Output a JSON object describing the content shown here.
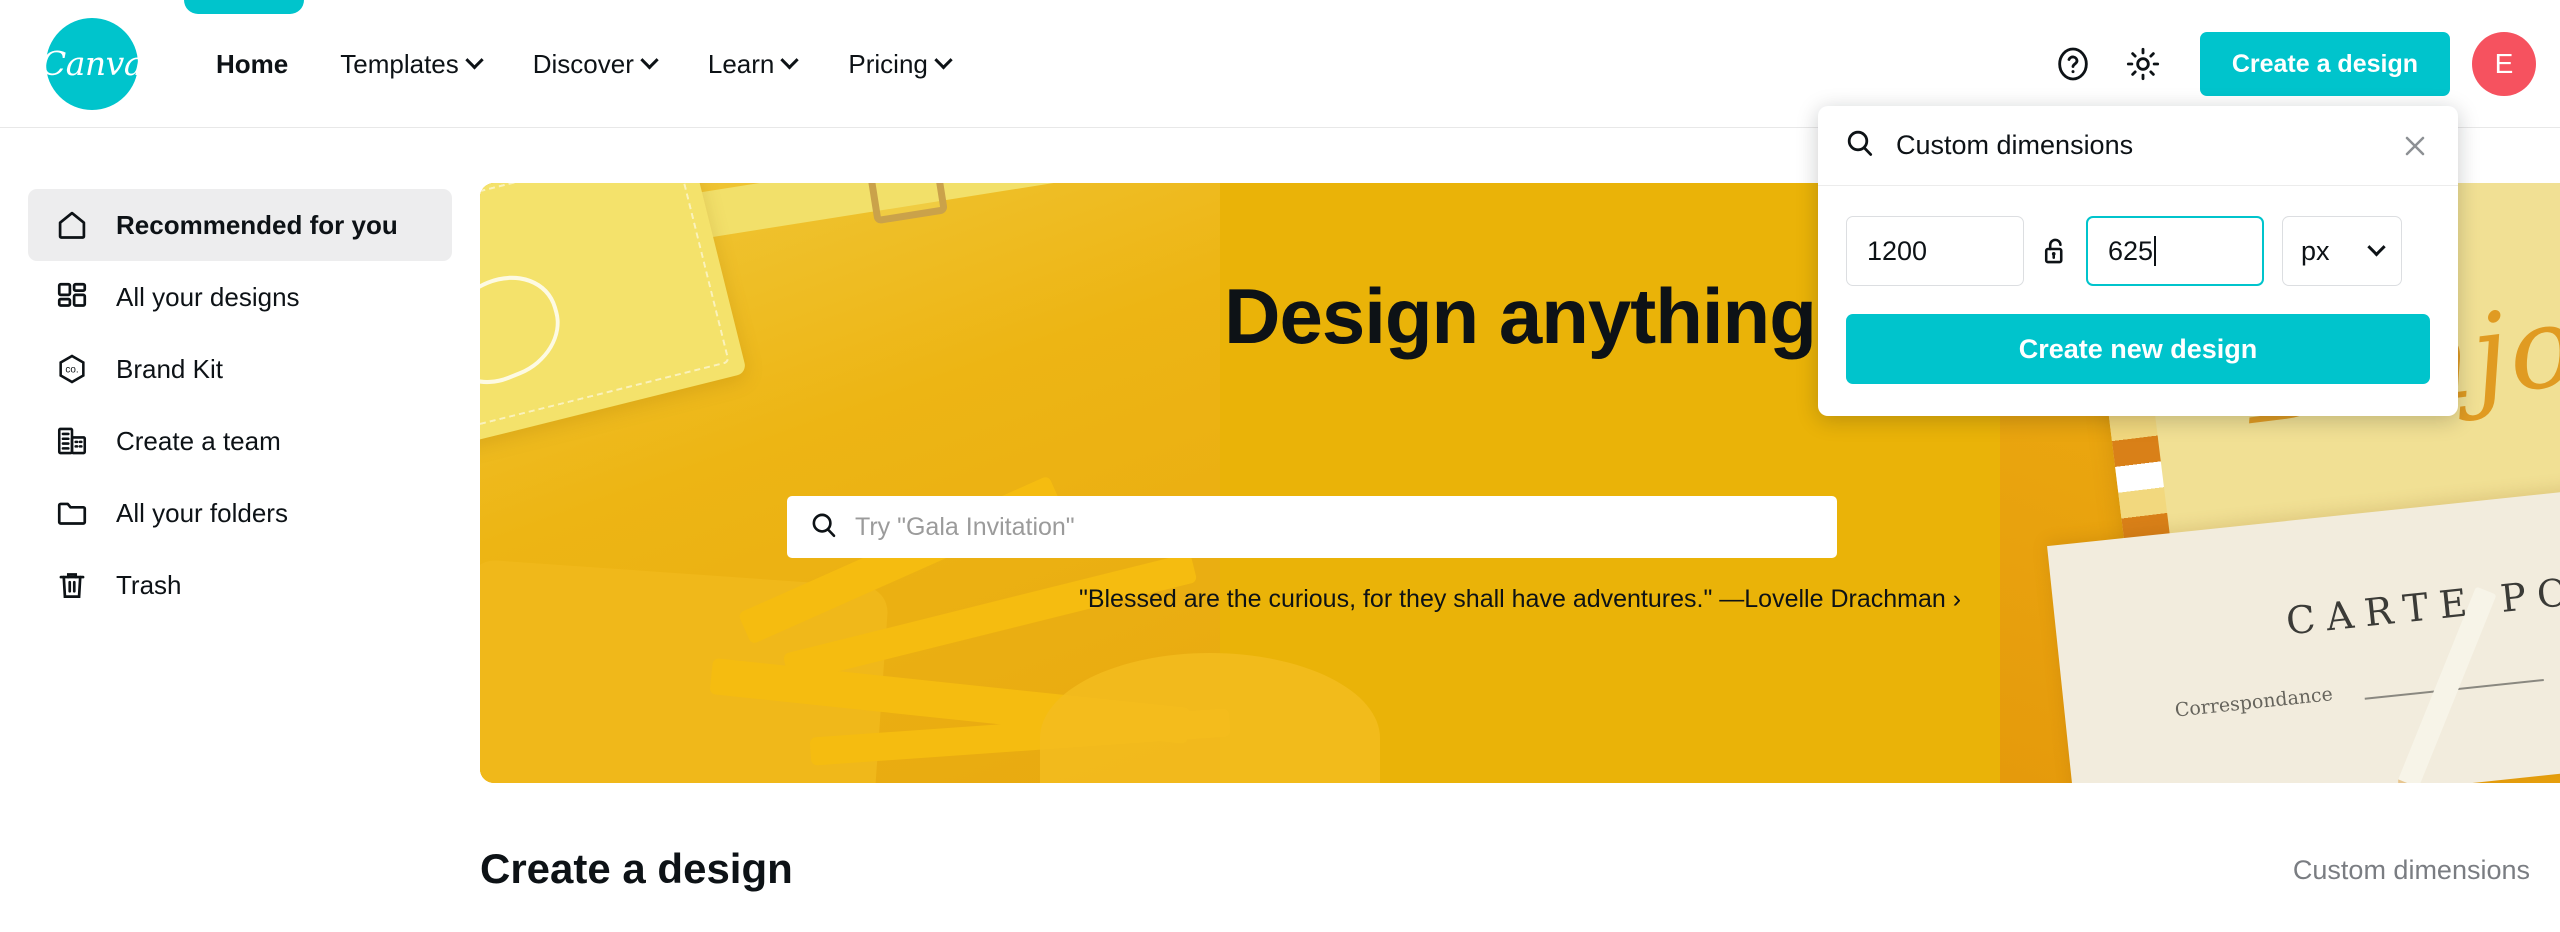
{
  "brand": {
    "logo_text": "Canva",
    "accent_color": "#00c4cc",
    "avatar_color": "#f6525f",
    "banner_color": "#eab308"
  },
  "header": {
    "nav": [
      {
        "label": "Home",
        "has_chevron": false,
        "active": true
      },
      {
        "label": "Templates",
        "has_chevron": true,
        "active": false
      },
      {
        "label": "Discover",
        "has_chevron": true,
        "active": false
      },
      {
        "label": "Learn",
        "has_chevron": true,
        "active": false
      },
      {
        "label": "Pricing",
        "has_chevron": true,
        "active": false
      }
    ],
    "help_icon": "help-circle-icon",
    "settings_icon": "gear-icon",
    "create_design_label": "Create a design",
    "avatar_initial": "E"
  },
  "sidebar": {
    "items": [
      {
        "label": "Recommended for you",
        "icon": "home-icon",
        "active": true
      },
      {
        "label": "All your designs",
        "icon": "grid-icon",
        "active": false
      },
      {
        "label": "Brand Kit",
        "icon": "brand-hexagon-icon",
        "active": false
      },
      {
        "label": "Create a team",
        "icon": "building-icon",
        "active": false
      },
      {
        "label": "All your folders",
        "icon": "folder-icon",
        "active": false
      },
      {
        "label": "Trash",
        "icon": "trash-icon",
        "active": false
      }
    ]
  },
  "banner": {
    "title": "Design anything",
    "search_placeholder": "Try \"Gala Invitation\"",
    "search_icon": "search-icon",
    "quote": "\"Blessed are the curious, for they shall have adventures.\" —Lovelle Drachman ›",
    "art": {
      "postcard_script": "Bonjour",
      "postcard_title": "CARTE POSTALE",
      "postcard_sub": "Correspondance"
    }
  },
  "main": {
    "section_title": "Create a design",
    "custom_dimensions_link": "Custom dimensions"
  },
  "popup": {
    "search_value": "Custom dimensions",
    "search_icon": "search-icon",
    "close_icon": "close-icon",
    "width_value": "1200",
    "height_value": "625",
    "lock_icon": "unlock-icon",
    "lock_state": "unlocked",
    "unit_value": "px",
    "unit_chevron_icon": "chevron-down-icon",
    "submit_label": "Create new design",
    "focused_field": "height"
  }
}
